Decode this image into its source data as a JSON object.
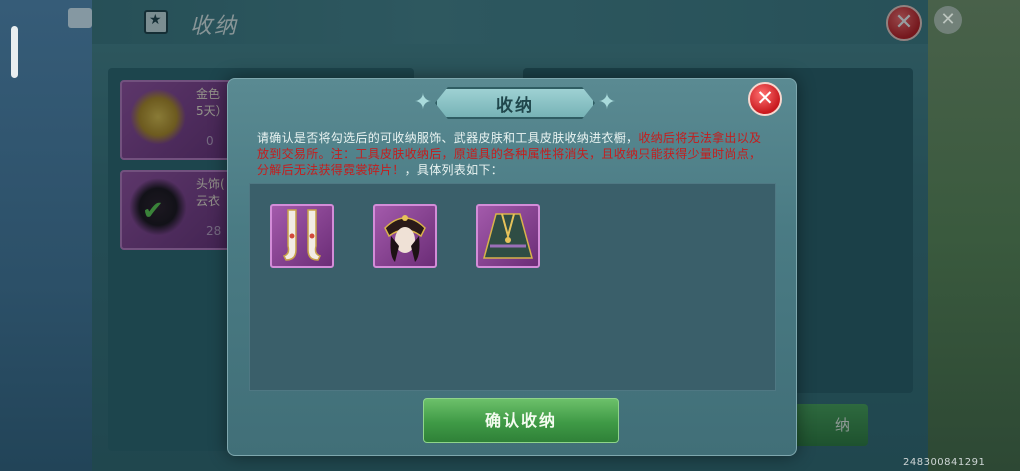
{
  "window": {
    "title": "收纳",
    "close_glyph": "✕",
    "edge_close_glyph": "✕"
  },
  "background_cards": [
    {
      "text": "金色\n5天）",
      "count": "0"
    },
    {
      "text": "头饰(\n云衣",
      "count": "28"
    }
  ],
  "background_button": {
    "label": "纳"
  },
  "dialog": {
    "title": "收纳",
    "close_glyph": "✕",
    "notice": {
      "part1": "请确认是否将勾选后的可收纳服饰、武器皮肤和工具皮肤收纳进衣橱，",
      "part2": "收纳后将无法拿出以及放到交易所。注：工具皮肤收纳后，原道具的各种属性将消失，且收纳只能获得少量时尚点，分解后无法获得霓裳碎片！",
      "part3": "，具体列表如下："
    },
    "items": [
      {
        "icon": "boots-icon"
      },
      {
        "icon": "headdress-icon"
      },
      {
        "icon": "robe-icon"
      }
    ],
    "confirm_label": "确认收纳"
  },
  "footer": {
    "id_text": "248300841291"
  },
  "colors": {
    "warning_red": "#c51d1d",
    "confirm_green": "#3f9a46",
    "item_purple": "#a35aab"
  }
}
